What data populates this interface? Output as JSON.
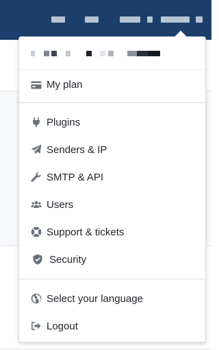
{
  "menu": {
    "items": [
      {
        "label": "My plan",
        "icon": "credit-card-icon"
      },
      {
        "label": "Plugins",
        "icon": "plug-icon"
      },
      {
        "label": "Senders & IP",
        "icon": "paper-plane-icon"
      },
      {
        "label": "SMTP & API",
        "icon": "wrench-icon"
      },
      {
        "label": "Users",
        "icon": "users-icon"
      },
      {
        "label": "Support & tickets",
        "icon": "life-ring-icon"
      },
      {
        "label": "Security",
        "icon": "shield-icon"
      },
      {
        "label": "Select your language",
        "icon": "globe-icon"
      },
      {
        "label": "Logout",
        "icon": "sign-out-icon"
      }
    ]
  },
  "colors": {
    "topbar": "#1b3f6a",
    "icon": "#6a727c",
    "text": "#1f2329"
  }
}
